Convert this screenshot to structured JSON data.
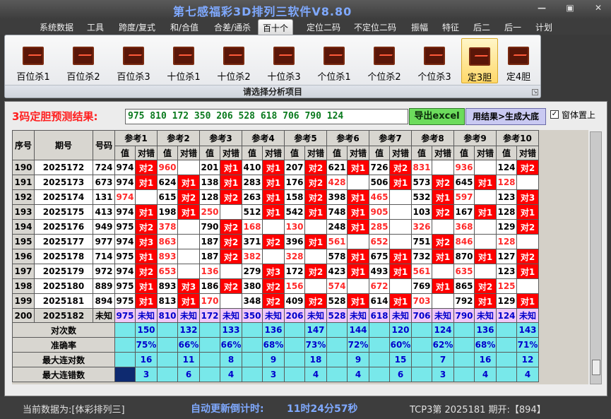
{
  "app": {
    "title": "第七感福彩3D排列三软件V8.80",
    "minimize": "—",
    "restore": "▣",
    "close": "✕"
  },
  "menu": [
    "系统数据",
    "工具",
    "跨度/复式",
    "和/合值",
    "合差/通杀",
    "百十个",
    "定位二码",
    "不定位二码",
    "振幅",
    "特征",
    "后二",
    "后一",
    "计划"
  ],
  "menu_active": 5,
  "ribbon": {
    "buttons": [
      "百位杀1",
      "百位杀2",
      "百位杀3",
      "十位杀1",
      "十位杀2",
      "十位杀3",
      "个位杀1",
      "个位杀2",
      "个位杀3",
      "定3胆",
      "定4胆"
    ],
    "selected": 9,
    "caption": "请选择分析项目"
  },
  "prediction": {
    "label": "3码定胆预测结果:",
    "value": "975 810 172 350 206 528 618 706 790 124",
    "export_label": "导出excel",
    "generate_label": "用结果>生成大底",
    "topmost_label": "窗体置上",
    "topmost_checked": "✓"
  },
  "table": {
    "headers": {
      "seq": "序号",
      "period": "期号",
      "code": "号码",
      "value": "值",
      "result": "对错"
    },
    "refs": [
      "参考1",
      "参考2",
      "参考3",
      "参考4",
      "参考5",
      "参考6",
      "参考7",
      "参考8",
      "参考9",
      "参考10"
    ],
    "rows": [
      {
        "seq": "190",
        "period": "2025172",
        "code": "724",
        "cells": [
          [
            "974",
            "对2"
          ],
          [
            "960",
            ""
          ],
          [
            "201",
            "对1"
          ],
          [
            "410",
            "对1"
          ],
          [
            "207",
            "对2"
          ],
          [
            "621",
            "对1"
          ],
          [
            "726",
            "对2"
          ],
          [
            "831",
            ""
          ],
          [
            "936",
            ""
          ],
          [
            "124",
            "对2"
          ]
        ]
      },
      {
        "seq": "191",
        "period": "2025173",
        "code": "673",
        "cells": [
          [
            "974",
            "对1"
          ],
          [
            "624",
            "对1"
          ],
          [
            "138",
            "对1"
          ],
          [
            "283",
            "对1"
          ],
          [
            "176",
            "对2"
          ],
          [
            "428",
            ""
          ],
          [
            "506",
            "对1"
          ],
          [
            "573",
            "对2"
          ],
          [
            "645",
            "对1"
          ],
          [
            "128",
            ""
          ]
        ]
      },
      {
        "seq": "192",
        "period": "2025174",
        "code": "131",
        "cells": [
          [
            "974",
            ""
          ],
          [
            "615",
            "对2"
          ],
          [
            "128",
            "对2"
          ],
          [
            "263",
            "对1"
          ],
          [
            "158",
            "对2"
          ],
          [
            "398",
            "对1"
          ],
          [
            "465",
            ""
          ],
          [
            "532",
            "对1"
          ],
          [
            "597",
            ""
          ],
          [
            "123",
            "对3"
          ]
        ]
      },
      {
        "seq": "193",
        "period": "2025175",
        "code": "413",
        "cells": [
          [
            "974",
            "对1"
          ],
          [
            "198",
            "对1"
          ],
          [
            "250",
            ""
          ],
          [
            "512",
            "对1"
          ],
          [
            "542",
            "对1"
          ],
          [
            "748",
            "对1"
          ],
          [
            "905",
            ""
          ],
          [
            "103",
            "对2"
          ],
          [
            "167",
            "对1"
          ],
          [
            "128",
            "对1"
          ]
        ]
      },
      {
        "seq": "194",
        "period": "2025176",
        "code": "949",
        "cells": [
          [
            "975",
            "对2"
          ],
          [
            "378",
            ""
          ],
          [
            "790",
            "对2"
          ],
          [
            "168",
            ""
          ],
          [
            "130",
            ""
          ],
          [
            "248",
            "对1"
          ],
          [
            "285",
            ""
          ],
          [
            "326",
            ""
          ],
          [
            "368",
            ""
          ],
          [
            "129",
            "对2"
          ]
        ]
      },
      {
        "seq": "195",
        "period": "2025177",
        "code": "977",
        "cells": [
          [
            "974",
            "对3"
          ],
          [
            "863",
            ""
          ],
          [
            "187",
            "对2"
          ],
          [
            "371",
            "对2"
          ],
          [
            "396",
            "对1"
          ],
          [
            "561",
            ""
          ],
          [
            "652",
            ""
          ],
          [
            "751",
            "对2"
          ],
          [
            "846",
            ""
          ],
          [
            "128",
            ""
          ]
        ]
      },
      {
        "seq": "196",
        "period": "2025178",
        "code": "714",
        "cells": [
          [
            "975",
            "对1"
          ],
          [
            "893",
            ""
          ],
          [
            "187",
            "对2"
          ],
          [
            "382",
            ""
          ],
          [
            "328",
            ""
          ],
          [
            "578",
            "对1"
          ],
          [
            "675",
            "对1"
          ],
          [
            "732",
            "对1"
          ],
          [
            "870",
            "对1"
          ],
          [
            "127",
            "对2"
          ]
        ]
      },
      {
        "seq": "197",
        "period": "2025179",
        "code": "972",
        "cells": [
          [
            "974",
            "对2"
          ],
          [
            "653",
            ""
          ],
          [
            "136",
            ""
          ],
          [
            "279",
            "对3"
          ],
          [
            "172",
            "对2"
          ],
          [
            "423",
            "对1"
          ],
          [
            "493",
            "对1"
          ],
          [
            "561",
            ""
          ],
          [
            "635",
            ""
          ],
          [
            "123",
            "对1"
          ]
        ]
      },
      {
        "seq": "198",
        "period": "2025180",
        "code": "889",
        "cells": [
          [
            "975",
            "对1"
          ],
          [
            "893",
            "对3"
          ],
          [
            "186",
            "对2"
          ],
          [
            "380",
            "对2"
          ],
          [
            "156",
            ""
          ],
          [
            "574",
            ""
          ],
          [
            "672",
            ""
          ],
          [
            "769",
            "对1"
          ],
          [
            "865",
            "对2"
          ],
          [
            "125",
            ""
          ]
        ]
      },
      {
        "seq": "199",
        "period": "2025181",
        "code": "894",
        "cells": [
          [
            "975",
            "对1"
          ],
          [
            "813",
            "对1"
          ],
          [
            "170",
            ""
          ],
          [
            "348",
            "对2"
          ],
          [
            "409",
            "对2"
          ],
          [
            "528",
            "对1"
          ],
          [
            "614",
            "对1"
          ],
          [
            "703",
            ""
          ],
          [
            "792",
            "对1"
          ],
          [
            "129",
            "对1"
          ]
        ]
      }
    ],
    "pending": {
      "seq": "200",
      "period": "2025182",
      "code": "未知",
      "cells": [
        [
          "975",
          "未知"
        ],
        [
          "810",
          "未知"
        ],
        [
          "172",
          "未知"
        ],
        [
          "350",
          "未知"
        ],
        [
          "206",
          "未知"
        ],
        [
          "528",
          "未知"
        ],
        [
          "618",
          "未知"
        ],
        [
          "706",
          "未知"
        ],
        [
          "790",
          "未知"
        ],
        [
          "124",
          "未知"
        ]
      ]
    },
    "stats": [
      {
        "label": "对次数",
        "values": [
          "150",
          "132",
          "133",
          "136",
          "147",
          "144",
          "120",
          "124",
          "136",
          "143"
        ]
      },
      {
        "label": "准确率",
        "values": [
          "75%",
          "66%",
          "66%",
          "68%",
          "73%",
          "72%",
          "60%",
          "62%",
          "68%",
          "71%"
        ]
      },
      {
        "label": "最大连对数",
        "values": [
          "16",
          "11",
          "8",
          "9",
          "18",
          "9",
          "15",
          "7",
          "16",
          "12"
        ]
      },
      {
        "label": "最大连错数",
        "values": [
          "3",
          "6",
          "4",
          "3",
          "4",
          "4",
          "6",
          "3",
          "4",
          "4"
        ]
      }
    ]
  },
  "statusbar": {
    "current_data": "当前数据为:[体彩排列三]",
    "countdown_label": "自动更新倒计时:",
    "countdown_value": "11时24分57秒",
    "draw_info": "TCP3第 2025181 期开:【894】"
  }
}
